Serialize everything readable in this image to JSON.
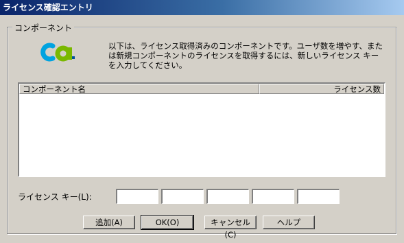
{
  "window": {
    "title": "ライセンス確認エントリ"
  },
  "group": {
    "label": "コンポーネント"
  },
  "logo": {
    "text": "ca",
    "colors": [
      "#00a3e0",
      "#7ab800",
      "#00529b"
    ]
  },
  "description": "以下は、ライセンス取得済みのコンポーネントです。ユーザ数を増やす、または新規コンポーネントのライセンスを取得するには、新しいライセンス キーを入力してください。",
  "list": {
    "columns": [
      "コンポーネント名",
      "ライセンス数"
    ],
    "rows": []
  },
  "license_key": {
    "label": "ライセンス キー(L):",
    "fields": [
      "",
      "",
      "",
      "",
      ""
    ]
  },
  "buttons": {
    "add": "追加(A)",
    "ok": "OK(O)",
    "cancel": "キャンセル(C)",
    "help": "ヘルプ"
  }
}
